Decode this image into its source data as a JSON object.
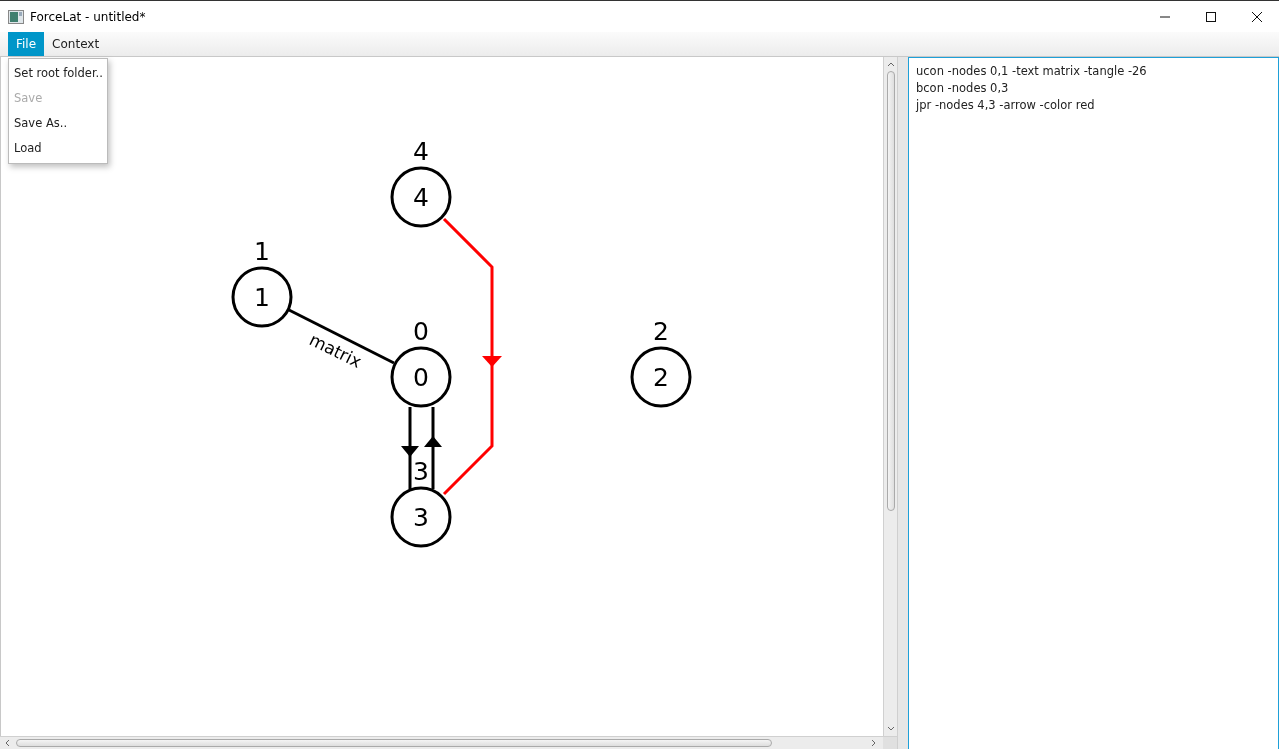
{
  "window": {
    "title": "ForceLat - untitled*"
  },
  "menu": [
    {
      "label": "File",
      "selected": true
    },
    {
      "label": "Context",
      "selected": false
    }
  ],
  "file_menu": [
    {
      "label": "Set root folder..",
      "disabled": false
    },
    {
      "label": "Save",
      "disabled": true
    },
    {
      "label": "Save As..",
      "disabled": false
    },
    {
      "label": "Load",
      "disabled": false
    }
  ],
  "canvas": {
    "nodes": [
      {
        "label": "4",
        "caption": "4"
      },
      {
        "label": "1",
        "caption": "1"
      },
      {
        "label": "0",
        "caption": "0"
      },
      {
        "label": "2",
        "caption": "2"
      },
      {
        "label": "3",
        "caption": "3"
      }
    ],
    "edges": [
      {
        "kind": "ucon",
        "text": "matrix",
        "color": "#000000"
      },
      {
        "kind": "bcon",
        "color": "#000000"
      },
      {
        "kind": "jpr",
        "color": "#ff0000"
      }
    ]
  },
  "editor": {
    "lines": [
      "ucon -nodes 0,1 -text matrix -tangle -26",
      "bcon -nodes 0,3",
      "jpr -nodes 4,3 -arrow -color red"
    ]
  }
}
